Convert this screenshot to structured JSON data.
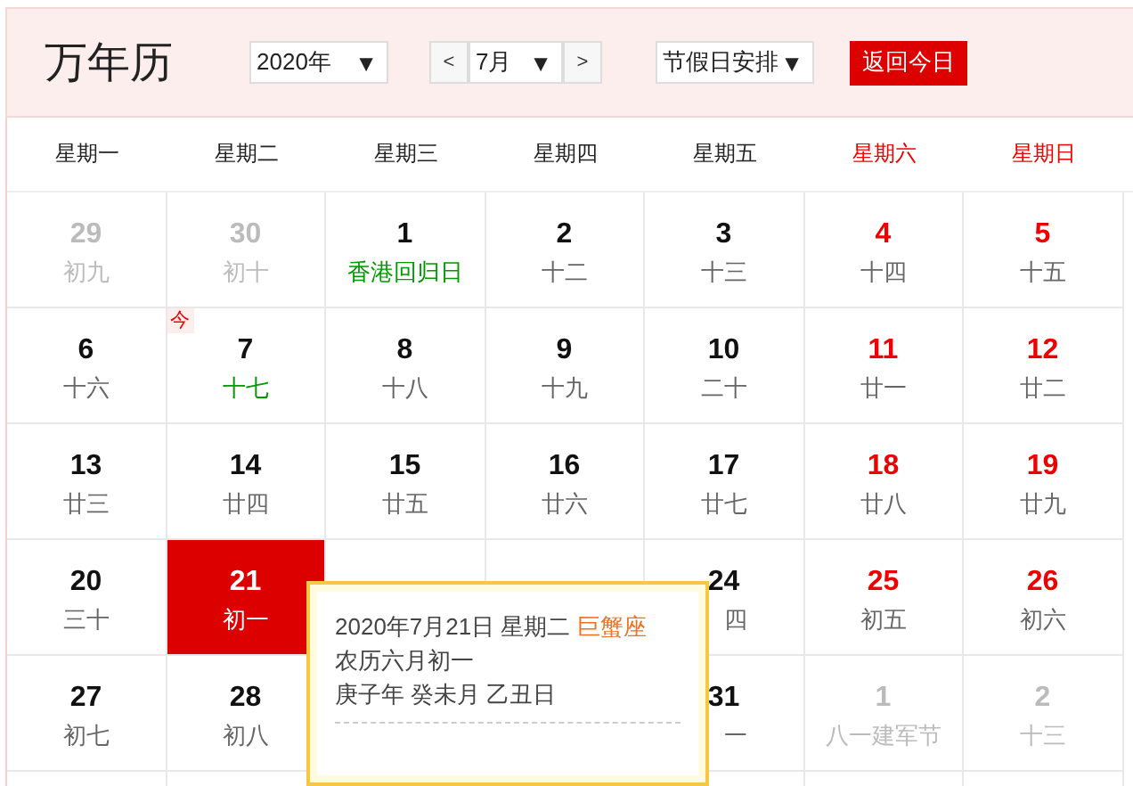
{
  "header": {
    "title": "万年历",
    "year_select": {
      "value": "2020年",
      "arrow": "▼"
    },
    "prev_button": "<",
    "month_select": {
      "value": "7月",
      "arrow": "▼"
    },
    "next_button": ">",
    "holiday_select": {
      "value": "节假日安排",
      "arrow": "▼"
    },
    "today_button": "返回今日"
  },
  "weekdays": [
    {
      "label": "星期一",
      "weekend": false
    },
    {
      "label": "星期二",
      "weekend": false
    },
    {
      "label": "星期三",
      "weekend": false
    },
    {
      "label": "星期四",
      "weekend": false
    },
    {
      "label": "星期五",
      "weekend": false
    },
    {
      "label": "星期六",
      "weekend": true
    },
    {
      "label": "星期日",
      "weekend": true
    }
  ],
  "weeks": [
    [
      {
        "kind": "other",
        "day": "29",
        "lunar": "初九"
      },
      {
        "kind": "other",
        "day": "30",
        "lunar": "初十"
      },
      {
        "kind": "normal",
        "day": "1",
        "lunar": "香港回归日",
        "festival": true
      },
      {
        "kind": "normal",
        "day": "2",
        "lunar": "十二",
        "festival": false
      },
      {
        "kind": "normal",
        "day": "3",
        "lunar": "十三",
        "festival": false
      },
      {
        "kind": "weekend",
        "day": "4",
        "lunar": "十四",
        "festival": false
      },
      {
        "kind": "weekend",
        "day": "5",
        "lunar": "十五",
        "festival": false
      }
    ],
    [
      {
        "kind": "normal",
        "day": "6",
        "lunar": "十六",
        "festival": false
      },
      {
        "kind": "normal",
        "day": "7",
        "lunar": "十七",
        "festival": true,
        "badge": "今"
      },
      {
        "kind": "normal",
        "day": "8",
        "lunar": "十八",
        "festival": false
      },
      {
        "kind": "normal",
        "day": "9",
        "lunar": "十九",
        "festival": false
      },
      {
        "kind": "normal",
        "day": "10",
        "lunar": "二十",
        "festival": false
      },
      {
        "kind": "weekend",
        "day": "11",
        "lunar": "廿一",
        "festival": false
      },
      {
        "kind": "weekend",
        "day": "12",
        "lunar": "廿二",
        "festival": false
      }
    ],
    [
      {
        "kind": "normal",
        "day": "13",
        "lunar": "廿三",
        "festival": false
      },
      {
        "kind": "normal",
        "day": "14",
        "lunar": "廿四",
        "festival": false
      },
      {
        "kind": "normal",
        "day": "15",
        "lunar": "廿五",
        "festival": false
      },
      {
        "kind": "normal",
        "day": "16",
        "lunar": "廿六",
        "festival": false
      },
      {
        "kind": "normal",
        "day": "17",
        "lunar": "廿七",
        "festival": false
      },
      {
        "kind": "weekend",
        "day": "18",
        "lunar": "廿八",
        "festival": false
      },
      {
        "kind": "weekend",
        "day": "19",
        "lunar": "廿九",
        "festival": false
      }
    ],
    [
      {
        "kind": "normal",
        "day": "20",
        "lunar": "三十",
        "festival": false
      },
      {
        "kind": "selected",
        "day": "21",
        "lunar": "初一"
      },
      {
        "kind": "covered"
      },
      {
        "kind": "covered"
      },
      {
        "kind": "partial",
        "day": "24",
        "lunar": "四"
      },
      {
        "kind": "weekend",
        "day": "25",
        "lunar": "初五",
        "festival": false
      },
      {
        "kind": "weekend",
        "day": "26",
        "lunar": "初六",
        "festival": false
      }
    ],
    [
      {
        "kind": "normal",
        "day": "27",
        "lunar": "初七",
        "festival": false
      },
      {
        "kind": "normal",
        "day": "28",
        "lunar": "初八",
        "festival": false
      },
      {
        "kind": "hidden"
      },
      {
        "kind": "hidden"
      },
      {
        "kind": "partial",
        "day": "31",
        "lunar": "一"
      },
      {
        "kind": "other",
        "day": "1",
        "lunar": "八一建军节"
      },
      {
        "kind": "other",
        "day": "2",
        "lunar": "十三"
      }
    ]
  ],
  "tooltip": {
    "date": "2020年7月21日 星期二",
    "constellation": "巨蟹座",
    "lunar": "农历六月初一",
    "ganzhi": "庚子年 癸未月 乙丑日"
  }
}
